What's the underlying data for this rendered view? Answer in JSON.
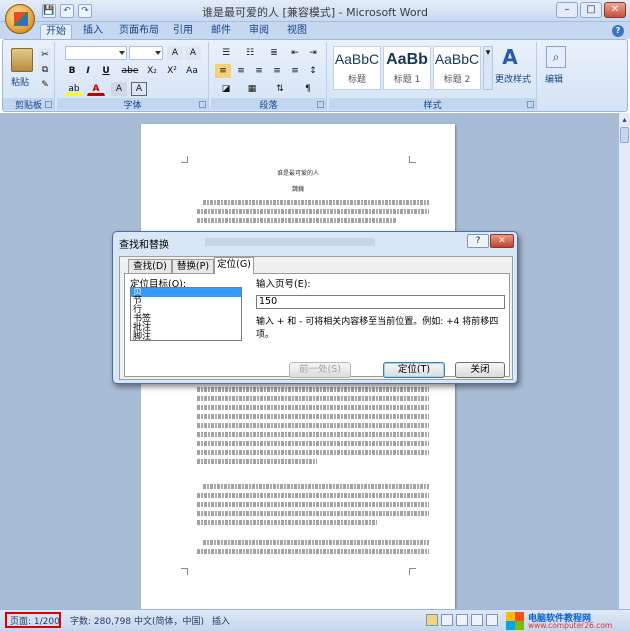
{
  "window": {
    "title": "谁是最可爱的人 [兼容模式] - Microsoft Word",
    "minimize": "–",
    "maximize": "□",
    "close": "✕"
  },
  "qat": {
    "save": "💾",
    "undo": "↶",
    "redo": "↷"
  },
  "tabs": [
    "开始",
    "插入",
    "页面布局",
    "引用",
    "邮件",
    "审阅",
    "视图"
  ],
  "ribbon": {
    "groups": {
      "clipboard": "剪贴板",
      "font": "字体",
      "paragraph": "段落",
      "styles": "样式"
    },
    "paste_label": "粘贴",
    "font_buttons": [
      "B",
      "I",
      "U",
      "abe",
      "X₂",
      "X²",
      "Aa"
    ],
    "style_items": [
      {
        "preview": "AaBbC",
        "name": "标题"
      },
      {
        "preview": "AaBb",
        "name": "标题 1"
      },
      {
        "preview": "AaBbC",
        "name": "标题 2"
      }
    ],
    "change_style": "更改样式",
    "edit": "编辑"
  },
  "document": {
    "title": "谁是最可爱的人",
    "author": "魏巍"
  },
  "dialog": {
    "title": "查找和替换",
    "help": "?",
    "close": "✕",
    "tabs": [
      "查找(D)",
      "替换(P)",
      "定位(G)"
    ],
    "goto_target_label": "定位目标(O):",
    "goto_targets": [
      "页",
      "节",
      "行",
      "书签",
      "批注",
      "脚注"
    ],
    "selected_target": "页",
    "page_number_label": "输入页号(E):",
    "page_number_value": "150",
    "hint": "输入 + 和 - 可将相关内容移至当前位置。例如: +4 将前移四项。",
    "buttons": {
      "previous": "前一处(S)",
      "goto": "定位(T)",
      "close": "关闭"
    }
  },
  "statusbar": {
    "page": "页面: 1/200",
    "words": "字数: 280,798",
    "language": "中文(简体，中国)",
    "mode": "插入"
  },
  "watermark": {
    "line1": "电脑软件教程网",
    "line2": "www.computer26.com"
  },
  "colors": {
    "ribbon_text": "#15428b",
    "highlight": "#e00000",
    "selection": "#3399ff"
  }
}
